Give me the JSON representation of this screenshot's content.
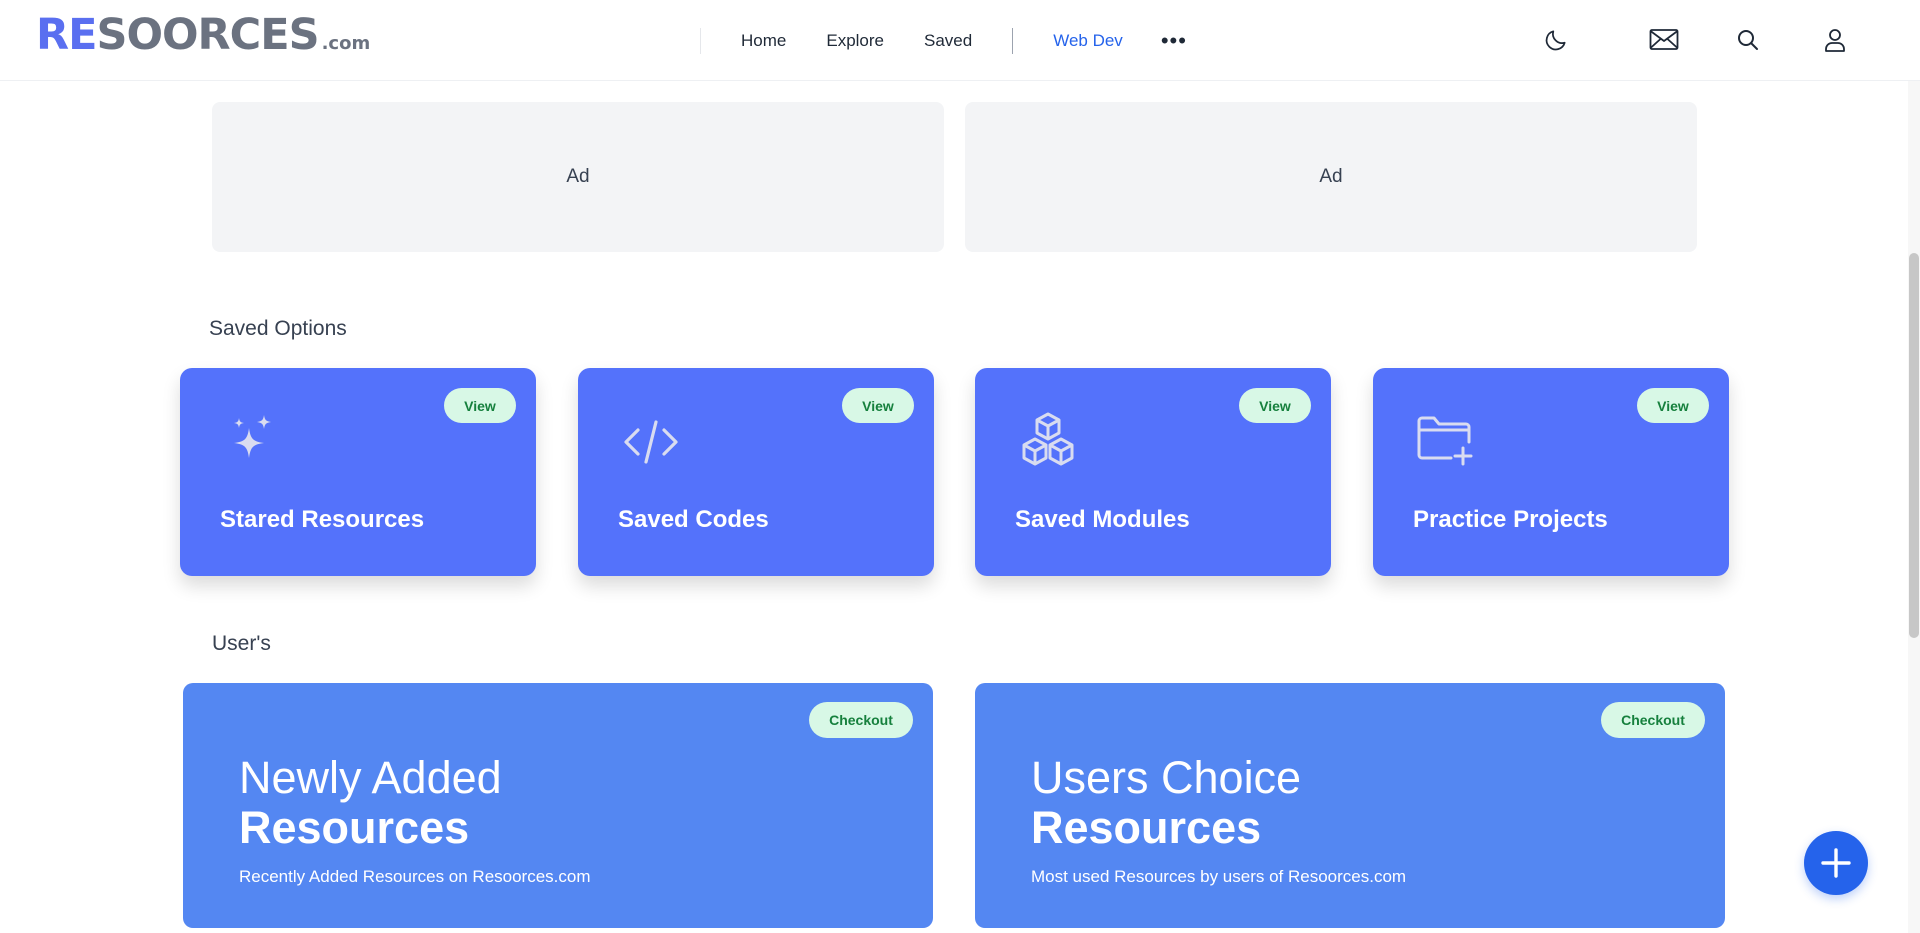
{
  "header": {
    "logo_main_blue": "RE",
    "logo_main_gray": "SOORCES",
    "logo_suffix": ".com",
    "nav": [
      {
        "label": "Home"
      },
      {
        "label": "Explore"
      },
      {
        "label": "Saved"
      }
    ],
    "active_category": "Web Dev",
    "more_label": "•••",
    "icons": [
      "moon-icon",
      "mail-icon",
      "search-icon",
      "user-icon"
    ]
  },
  "ads": [
    "Ad",
    "Ad"
  ],
  "saved_options": {
    "title": "Saved Options",
    "cards": [
      {
        "title": "Stared Resources",
        "action": "View",
        "icon": "sparkles-icon"
      },
      {
        "title": "Saved Codes",
        "action": "View",
        "icon": "code-icon"
      },
      {
        "title": "Saved Modules",
        "action": "View",
        "icon": "cubes-icon"
      },
      {
        "title": "Practice Projects",
        "action": "View",
        "icon": "folder-plus-icon"
      }
    ]
  },
  "users": {
    "title": "User's",
    "cards": [
      {
        "line1": "Newly Added",
        "line2": "Resources",
        "description": "Recently Added Resources on Resoorces.com",
        "action": "Checkout"
      },
      {
        "line1": "Users Choice",
        "line2": "Resources",
        "description": "Most used Resources by users of Resoorces.com",
        "action": "Checkout"
      }
    ]
  },
  "colors": {
    "accent": "#5472fb",
    "users_card": "#5487f2",
    "badge_bg": "#d8f8e6",
    "badge_text": "#16803d",
    "fab": "#2563eb",
    "active_nav": "#2563eb"
  }
}
